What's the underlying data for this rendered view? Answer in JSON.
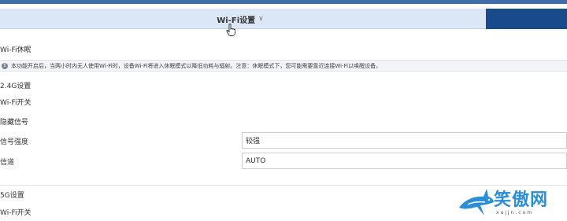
{
  "header": {
    "active_tab": "Wi-Fi设置",
    "chevron_icon": "chevron-down-icon"
  },
  "sleep_section": {
    "title": "Wi-Fi休眠",
    "notice": "本功能开启后，当两小时内无人使用Wi-Fi时，设备Wi-Fi将进入休眠模式以降低功耗与辐射。注意：休眠模式下，您可能需要靠近连接Wi-Fi以唤醒设备。",
    "info_icon": "info-icon"
  },
  "band_24g": {
    "title": "2.4G设置",
    "wifi_switch_label": "Wi-Fi开关",
    "hidden_ssid_label": "隐藏信号",
    "signal_strength_label": "信号强度",
    "signal_strength_value": "较强",
    "channel_label": "信道",
    "channel_value": "AUTO"
  },
  "band_5g": {
    "title": "5G设置",
    "wifi_switch_label": "Wi-Fi开关"
  },
  "watermark": {
    "title": "笑傲网",
    "url": "xajjn.com"
  },
  "colors": {
    "topbar": "#3d6ea8",
    "tabstrip": "#dbe6f6",
    "tab_right": "#184a8c",
    "watermark": "#2b8ed6"
  }
}
